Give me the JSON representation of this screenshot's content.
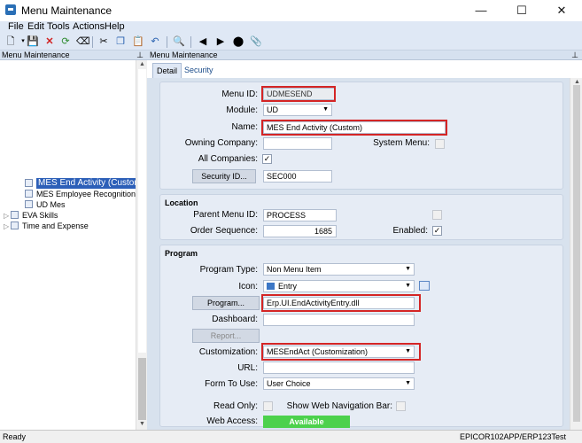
{
  "window": {
    "title": "Menu Maintenance",
    "minimize": "—",
    "maximize": "☐",
    "close": "✕"
  },
  "menubar": [
    "File",
    "Edit",
    "Tools",
    "Actions",
    "Help"
  ],
  "left_panel": {
    "header": "Menu Maintenance",
    "pin": "📌",
    "tree": [
      {
        "label": "MES End Activity (Custom)",
        "selected": true
      },
      {
        "label": "MES Employee Recognition",
        "selected": false
      },
      {
        "label": "UD Mes",
        "selected": false
      },
      {
        "label": "EVA Skills",
        "selected": false
      },
      {
        "label": "Time and Expense",
        "selected": false
      }
    ]
  },
  "right_panel": {
    "header": "Menu Maintenance",
    "pin": "📌",
    "tabs": [
      "Detail",
      "Security"
    ]
  },
  "detail": {
    "menu_id_label": "Menu ID:",
    "menu_id_value": "UDMESEND",
    "module_label": "Module:",
    "module_value": "UD",
    "name_label": "Name:",
    "name_value": "MES End Activity (Custom)",
    "owning_company_label": "Owning Company:",
    "owning_company_value": "",
    "system_menu_label": "System Menu:",
    "all_companies_label": "All Companies:",
    "all_companies_checked": "✓",
    "security_id_button": "Security ID...",
    "security_id_value": "SEC000"
  },
  "location": {
    "title": "Location",
    "parent_menu_label": "Parent Menu ID:",
    "parent_menu_value": "PROCESS",
    "order_sequence_label": "Order Sequence:",
    "order_sequence_value": "1685",
    "enabled_label": "Enabled:",
    "enabled_checked": "✓"
  },
  "program": {
    "title": "Program",
    "program_type_label": "Program Type:",
    "program_type_value": "Non Menu Item",
    "icon_label": "Icon:",
    "icon_value": "Entry",
    "program_button": "Program...",
    "program_value": "Erp.UI.EndActivityEntry.dll",
    "dashboard_label": "Dashboard:",
    "report_button": "Report...",
    "customization_label": "Customization:",
    "customization_value": "MESEndAct (Customization)",
    "url_label": "URL:",
    "form_to_use_label": "Form To Use:",
    "form_to_use_value": "User Choice",
    "read_only_label": "Read Only:",
    "show_web_nav_label": "Show Web Navigation Bar:",
    "web_access_label": "Web Access:",
    "web_access_value": "Available"
  },
  "status": {
    "left": "Ready",
    "right": "EPICOR102APP/ERP123Test"
  },
  "colors": {
    "accent": "#2c5fb8",
    "highlight_border": "#d42525",
    "available": "#4cd14c"
  }
}
